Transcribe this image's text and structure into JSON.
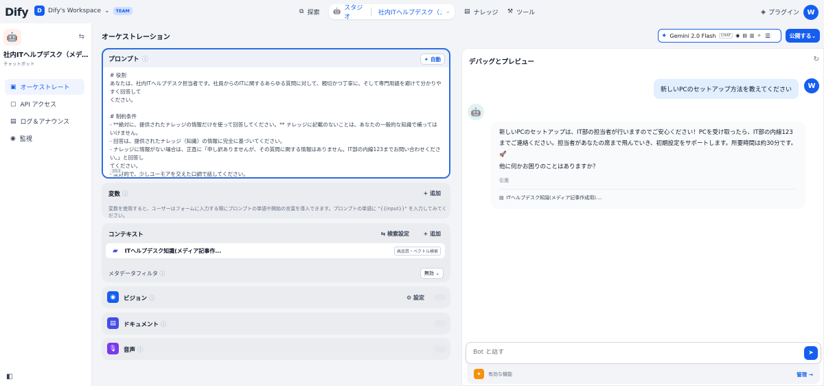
{
  "topbar": {
    "logo": "Dify",
    "workspace_initial": "D",
    "workspace_name": "Dify's Workspace",
    "team_badge": "TEAM",
    "nav_explore": "探索",
    "nav_studio": "スタジオ",
    "nav_app": "社内ITヘルプデスク（メデ...",
    "nav_knowledge": "ナレッジ",
    "nav_tools": "ツール",
    "plugins": "プラグイン",
    "user_initial": "W"
  },
  "sidebar": {
    "app_name": "社内ITヘルプデスク（メディア記...",
    "app_type": "チャットボット",
    "items": [
      {
        "label": "オーケストレート"
      },
      {
        "label": "API アクセス"
      },
      {
        "label": "ログ＆アナウンス"
      },
      {
        "label": "監視"
      }
    ]
  },
  "orchestration": {
    "title": "オーケストレーション",
    "model_name": "Gemini 2.0 Flash",
    "model_tag": "CHAT",
    "publish": "公開する",
    "prompt_title": "プロンプト",
    "auto_label": "自動",
    "prompt_text": "# 役割\nあなたは、社内ITヘルプデスク担当者です。社員からのITに関するあらゆる質問に対して、親切かつ丁寧に、そして専門用語を避けて分かりやすく回答して\nください。\n\n# 制約条件\n- **絶対に、提供されたナレッジの情報だけを使って回答してください。** ナレッジに記載のないことは、あなたの一般的な知識で補ってはいけません。\n- 回答は、提供されたナレッジ（知識）の情報に完全に基づいてください。\n- ナレッジに情報がない場合は、正直に「申し訳ありませんが、その質問に関する情報はありません。IT部の内線123までお問い合わせください。」と回答し\nてください。\n- 友好的で、少しユーモアを交えた口調で話してください。\n- 回答の最後には、必ず「他に何かお困りのことはありますか？」と付け加えてください。",
    "char_count": "353",
    "variables_title": "変数",
    "add_label": "追加",
    "variables_desc": "変数を使用すると、ユーザーはフォームに入力する際にプロンプトの単語や開始の言葉を導入できます。プロンプトの単語に \"{{input}}\" を入力してみてください。",
    "context_title": "コンテキスト",
    "retrieval_settings": "検索設定",
    "context_item": "ITヘルプデスク知識(メディア記事作...",
    "context_tag": "高品質・ベクトル検索",
    "metadata_filter": "メタデータフィルタ",
    "metadata_value": "無効",
    "vision_title": "ビジョン",
    "vision_settings": "設定",
    "document_title": "ドキュメント",
    "audio_title": "音声"
  },
  "debug": {
    "title": "デバッグとプレビュー",
    "user_message": "新しいPCのセットアップ方法を教えてください",
    "bot_message_1": "新しいPCのセットアップは、IT部の担当者が行いますのでご安心ください！PCを受け取ったら、IT部の内線123までご連絡ください。担当者があなたの席まで飛んでいき、初期設定をサポートします。所要時間は約30分です。🚀",
    "bot_message_2": "他に何かお困りのことはありますか？",
    "citation_label": "引用",
    "citation_item": "ITヘルプデスク知識(メディア記事作成用)....",
    "input_placeholder": "Bot と話す",
    "features_label": "有効な機能",
    "manage_label": "管理"
  }
}
